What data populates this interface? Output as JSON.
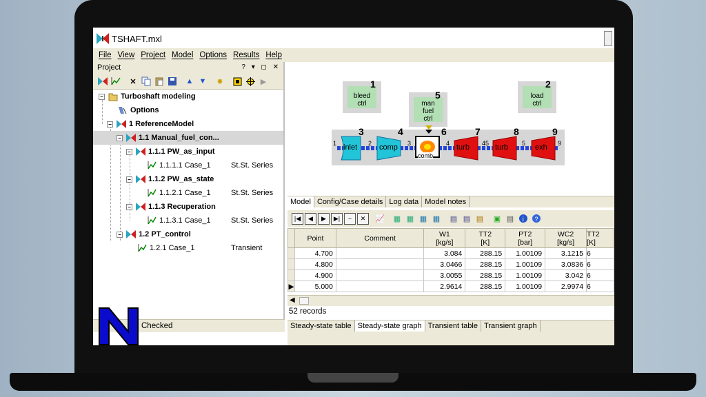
{
  "window": {
    "title": "TSHAFT.mxl"
  },
  "menu": [
    "File",
    "View",
    "Project",
    "Model",
    "Options",
    "Results",
    "Help"
  ],
  "project_panel": {
    "title": "Project",
    "controls": "? ▾ ◻ ✕"
  },
  "tree": [
    {
      "label": "Turboshaft modeling",
      "kind": ""
    },
    {
      "label": "Options",
      "kind": ""
    },
    {
      "label": "1 ReferenceModel",
      "kind": ""
    },
    {
      "label": "1.1 Manual_fuel_con...",
      "kind": ""
    },
    {
      "label": "1.1.1 PW_as_input",
      "kind": ""
    },
    {
      "label": "1.1.1.1 Case_1",
      "kind": "St.St. Series"
    },
    {
      "label": "1.1.2 PW_as_state",
      "kind": ""
    },
    {
      "label": "1.1.2.1 Case_1",
      "kind": "St.St. Series"
    },
    {
      "label": "1.1.3 Recuperation",
      "kind": ""
    },
    {
      "label": "1.1.3.1 Case_1",
      "kind": "St.St. Series"
    },
    {
      "label": "1.2 PT_control",
      "kind": ""
    },
    {
      "label": "1.2.1 Case_1",
      "kind": "Transient"
    }
  ],
  "status_left": "Checked",
  "diagram": {
    "controls": [
      {
        "label1": "bleed",
        "label2": "ctrl",
        "label3": "",
        "num": "1"
      },
      {
        "label1": "man",
        "label2": "fuel",
        "label3": "ctrl",
        "num": "5"
      },
      {
        "label1": "load",
        "label2": "ctrl",
        "label3": "",
        "num": "2"
      }
    ],
    "components": [
      {
        "label": "inlet",
        "num": "3",
        "color": "#22c4d8"
      },
      {
        "label": "comp",
        "num": "4",
        "color": "#22c4d8"
      },
      {
        "label": "comb",
        "num": "6",
        "color": "#ff8800"
      },
      {
        "label": "turb",
        "num": "7",
        "color": "#e01010"
      },
      {
        "label": "turb",
        "num": "8",
        "color": "#e01010"
      },
      {
        "label": "exh",
        "num": "9",
        "color": "#e01010"
      }
    ],
    "stations": [
      "1",
      "2",
      "3",
      "4",
      "45",
      "5",
      "9"
    ]
  },
  "upper_tabs": [
    "Model",
    "Config/Case details",
    "Log data",
    "Model notes"
  ],
  "table": {
    "headers": [
      {
        "line1": "Point",
        "line2": ""
      },
      {
        "line1": "Comment",
        "line2": ""
      },
      {
        "line1": "W1",
        "line2": "[kg/s]"
      },
      {
        "line1": "TT2",
        "line2": "[K]"
      },
      {
        "line1": "PT2",
        "line2": "[bar]"
      },
      {
        "line1": "WC2",
        "line2": "[kg/s]"
      },
      {
        "line1": "TT2",
        "line2": "[K]"
      }
    ],
    "rows": [
      {
        "point": "4.700",
        "comment": "",
        "w1": "3.084",
        "tt2": "288.15",
        "pt2": "1.00109",
        "wc2": "3.1215",
        "extra": "6"
      },
      {
        "point": "4.800",
        "comment": "",
        "w1": "3.0466",
        "tt2": "288.15",
        "pt2": "1.00109",
        "wc2": "3.0836",
        "extra": "6"
      },
      {
        "point": "4.900",
        "comment": "",
        "w1": "3.0055",
        "tt2": "288.15",
        "pt2": "1.00109",
        "wc2": "3.042",
        "extra": "6"
      },
      {
        "point": "5.000",
        "comment": "",
        "w1": "2.9614",
        "tt2": "288.15",
        "pt2": "1.00109",
        "wc2": "2.9974",
        "extra": "6"
      }
    ],
    "current_row_marker": "▶"
  },
  "records": "52  records",
  "bottom_tabs": [
    "Steady-state table",
    "Steady-state graph",
    "Transient table",
    "Transient graph"
  ]
}
